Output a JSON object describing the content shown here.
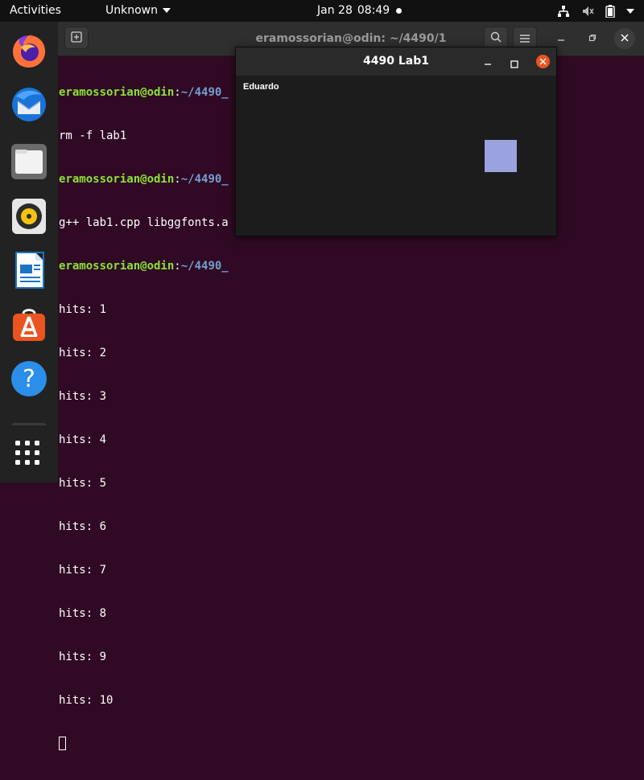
{
  "topbar": {
    "activities": "Activities",
    "app_menu": "Unknown",
    "date": "Jan 28",
    "time": "08:49"
  },
  "dock": {
    "items": [
      "firefox-icon",
      "thunderbird-icon",
      "files-icon",
      "rhythmbox-icon",
      "libreoffice-writer-icon",
      "software-center-icon",
      "help-icon",
      "terminal-icon",
      "show-apps-icon"
    ]
  },
  "terminal": {
    "title": "eramossorian@odin: ~/4490/1",
    "lines": [
      {
        "user": "eramossorian@odin",
        "path": "~/4490_",
        "cmd": ""
      },
      {
        "text": "rm -f lab1"
      },
      {
        "user": "eramossorian@odin",
        "path": "~/4490_",
        "cmd": "",
        "rest": "g++ lab1.cpp libggfonts.a"
      },
      {
        "user": "eramossorian@odin",
        "path": "~/4490_",
        "cmd": ""
      },
      {
        "text": "hits: 1"
      },
      {
        "text": "hits: 2"
      },
      {
        "text": "hits: 3"
      },
      {
        "text": "hits: 4"
      },
      {
        "text": "hits: 5"
      },
      {
        "text": "hits: 6"
      },
      {
        "text": "hits: 7"
      },
      {
        "text": "hits: 8"
      },
      {
        "text": "hits: 9"
      },
      {
        "text": "hits: 10"
      }
    ]
  },
  "lab_window": {
    "title": "4490 Lab1",
    "label": "Eduardo",
    "box_color": "#9ba3df"
  },
  "colors": {
    "desktop": "#300a24",
    "prompt_user": "#8ae234",
    "prompt_path": "#729fcf",
    "accent": "#e95420"
  }
}
